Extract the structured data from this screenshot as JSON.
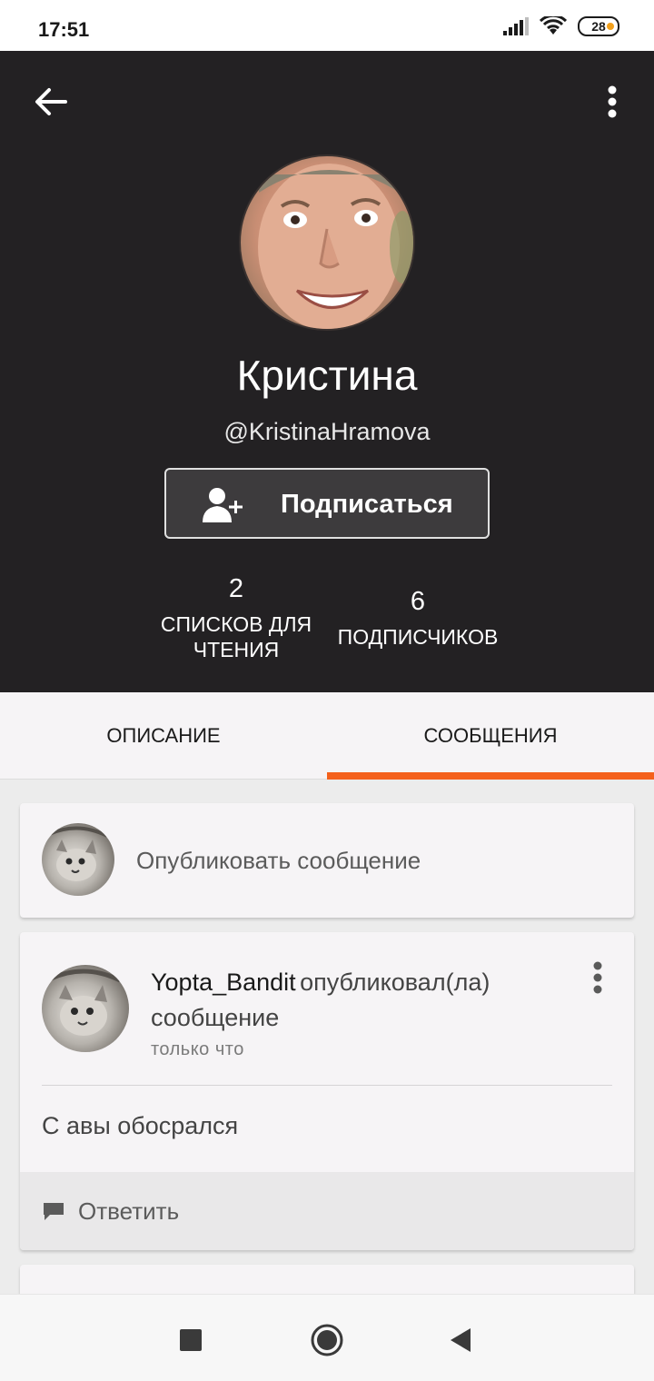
{
  "status_bar": {
    "time": "17:51",
    "battery": "28"
  },
  "profile": {
    "name": "Кристина",
    "handle": "@KristinaHramova",
    "subscribe_label": "Подписаться",
    "stats": [
      {
        "number": "2",
        "label_line1": "СПИСКОВ ДЛЯ",
        "label_line2": "ЧТЕНИЯ"
      },
      {
        "number": "6",
        "label_line1": "ПОДПИСЧИКОВ"
      }
    ]
  },
  "tabs": [
    {
      "label": "ОПИСАНИЕ"
    },
    {
      "label": "СООБЩЕНИЯ"
    }
  ],
  "compose": {
    "placeholder": "Опубликовать сообщение"
  },
  "post": {
    "author": "Yopta_Bandit",
    "action_line1": "опубликовал(ла)",
    "action_line2": "сообщение",
    "time": "только что",
    "body": "С авы обосрался",
    "reply_label": "Ответить"
  },
  "colors": {
    "accent": "#f4611c",
    "header_bg": "#232123"
  }
}
